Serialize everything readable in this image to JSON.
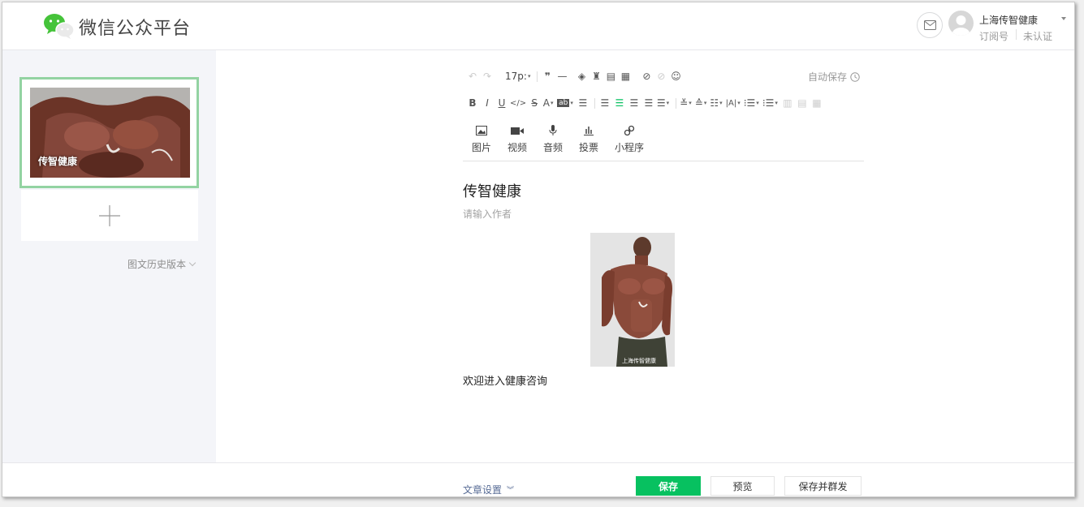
{
  "app": {
    "brand": "微信公众平台",
    "account_name": "上海传智健康",
    "account_type": "订阅号",
    "account_status": "未认证"
  },
  "sidebar": {
    "cover_title": "传智健康",
    "history_label": "图文历史版本"
  },
  "toolbar": {
    "font_size": "17p:",
    "autosave_label": "自动保存",
    "media": [
      {
        "label": "图片",
        "icon": "image-icon"
      },
      {
        "label": "视频",
        "icon": "video-icon"
      },
      {
        "label": "音频",
        "icon": "microphone-icon"
      },
      {
        "label": "投票",
        "icon": "poll-icon"
      },
      {
        "label": "小程序",
        "icon": "mini-program-icon"
      }
    ]
  },
  "article": {
    "title": "传智健康",
    "author_placeholder": "请输入作者",
    "image_watermark": "上海传智健康",
    "body": "欢迎进入健康咨询"
  },
  "footer": {
    "settings_label": "文章设置",
    "save_label": "保存",
    "preview_label": "预览",
    "publish_label": "保存并群发"
  },
  "colors": {
    "accent": "#07c160",
    "selected_border": "#93d3a2",
    "sidebar_bg": "#f4f5f9",
    "link": "#576b95"
  }
}
